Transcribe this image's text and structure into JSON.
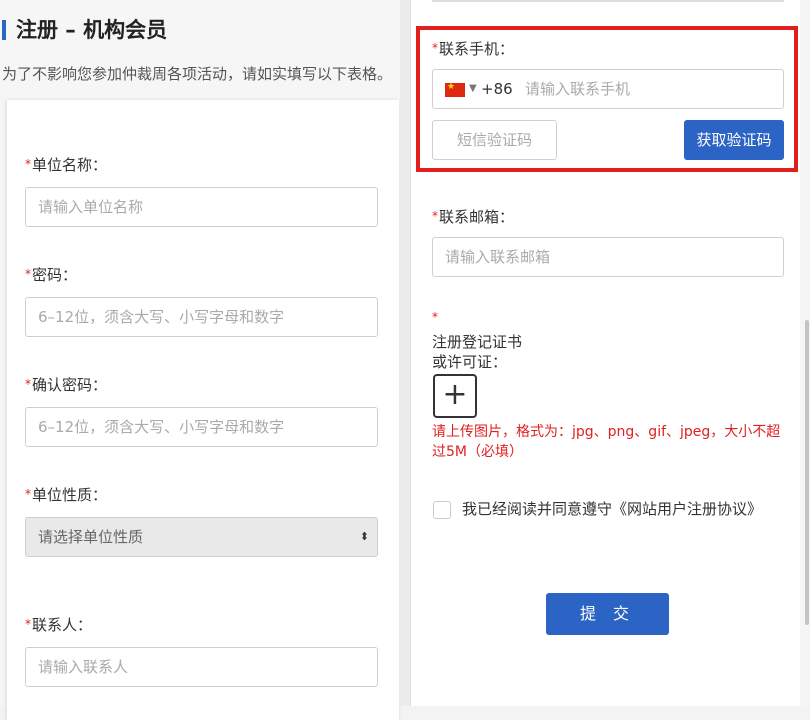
{
  "page": {
    "title": "注册 – 机构会员",
    "subtitle": "为了不影响您参加仲裁周各项活动，请如实填写以下表格。"
  },
  "left_form": {
    "org_name": {
      "label": "单位名称：",
      "placeholder": "请输入单位名称"
    },
    "password": {
      "label": "密码：",
      "placeholder": "6–12位，须含大写、小写字母和数字"
    },
    "confirm_password": {
      "label": "确认密码：",
      "placeholder": "6–12位，须含大写、小写字母和数字"
    },
    "org_type": {
      "label": "单位性质：",
      "placeholder": "请选择单位性质"
    },
    "contact_person": {
      "label": "联系人：",
      "placeholder": "请输入联系人"
    }
  },
  "right_form": {
    "mobile": {
      "label": "联系手机：",
      "country_code": "+86",
      "placeholder": "请输入联系手机",
      "sms_placeholder": "短信验证码",
      "get_code_label": "获取验证码"
    },
    "email": {
      "label": "联系邮箱：",
      "placeholder": "请输入联系邮箱"
    },
    "certificate": {
      "label_line1": "注册登记证书",
      "label_line2": "或许可证：",
      "hint": "请上传图片，格式为：jpg、png、gif、jpeg，大小不超过5M（必填）"
    },
    "agreement_text": "我已经阅读并同意遵守《网站用户注册协议》",
    "submit_label": "提 交"
  },
  "required_mark": "*",
  "icons": {
    "flag": "china-flag-icon",
    "caret": "caret-down-icon",
    "upload": "plus-icon",
    "select": "updown-chevron-icon"
  },
  "colors": {
    "primary": "#2b64c5",
    "required": "#e02020",
    "highlight": "#e31e1e"
  }
}
